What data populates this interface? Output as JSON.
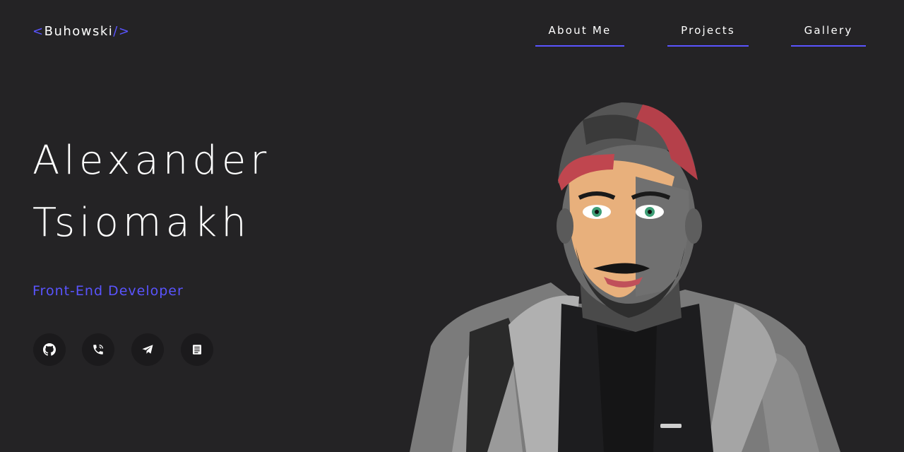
{
  "header": {
    "logo": {
      "open": "<",
      "text": "Buhowski",
      "close": "/>"
    },
    "nav": [
      {
        "label": "About Me"
      },
      {
        "label": "Projects"
      },
      {
        "label": "Gallery"
      }
    ]
  },
  "hero": {
    "first_name": "Alexander",
    "last_name": "Tsiomakh",
    "role": "Front-End Developer",
    "social": [
      {
        "icon": "github-icon"
      },
      {
        "icon": "phone-icon"
      },
      {
        "icon": "telegram-icon"
      },
      {
        "icon": "resume-icon"
      }
    ],
    "portrait_icon": "portrait-illustration"
  },
  "colors": {
    "background": "#242325",
    "accent": "#5a54ff",
    "text": "#ffffff",
    "icon_bg": "#1b1a1c"
  }
}
